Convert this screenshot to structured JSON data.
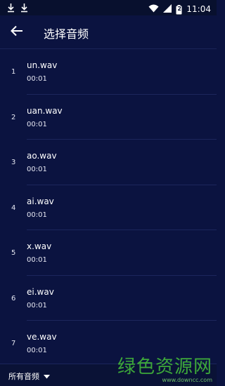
{
  "status_bar": {
    "time": "11:04",
    "battery_level": "2",
    "icons": [
      "download-icon",
      "download-icon",
      "wifi-icon",
      "signal-icon",
      "battery-icon"
    ]
  },
  "app_bar": {
    "title": "选择音频",
    "back_icon": "arrow-left-icon"
  },
  "list": {
    "items": [
      {
        "index": "1",
        "name": "un.wav",
        "duration": "00:01"
      },
      {
        "index": "2",
        "name": "uan.wav",
        "duration": "00:01"
      },
      {
        "index": "3",
        "name": "ao.wav",
        "duration": "00:01"
      },
      {
        "index": "4",
        "name": "ai.wav",
        "duration": "00:01"
      },
      {
        "index": "5",
        "name": "x.wav",
        "duration": "00:01"
      },
      {
        "index": "6",
        "name": "ei.wav",
        "duration": "00:01"
      },
      {
        "index": "7",
        "name": "ve.wav",
        "duration": "00:01"
      }
    ]
  },
  "bottom_bar": {
    "filter_label": "所有音频",
    "dropdown_icon": "triangle-down-icon"
  },
  "watermark": {
    "text": "绿色资源网",
    "url": "www.downcc.com"
  },
  "colors": {
    "background": "#0b1340",
    "watermark": "#3da83a"
  }
}
